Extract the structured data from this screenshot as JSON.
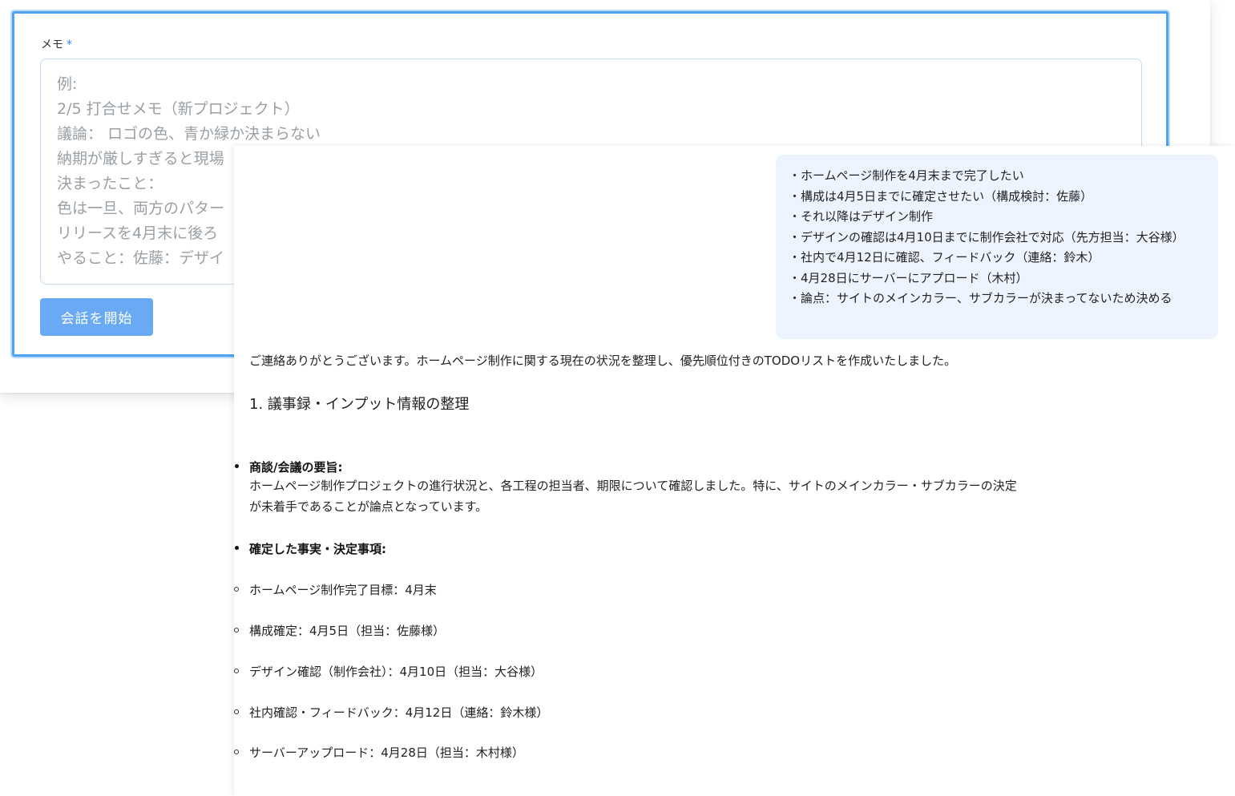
{
  "form": {
    "memo_label": "メモ",
    "required_mark": "*",
    "placeholder_lines": [
      "例:",
      "2/5 打合せメモ（新プロジェクト）",
      "議論： ロゴの色、青か緑か決まらない",
      "納期が厳しすぎると現場",
      "決まったこと：",
      "色は一旦、両方のパター",
      "リリースを4月末に後ろ",
      "やること：佐藤：デザイ"
    ],
    "start_button_label": "会話を開始"
  },
  "chat": {
    "user_message_lines": [
      "・ホームページ制作を4月末まで完了したい",
      "・構成は4月5日までに確定させたい（構成検討：佐藤）",
      "・それ以降はデザイン制作",
      "・デザインの確認は4月10日までに制作会社で対応（先方担当：大谷様）",
      "・社内で4月12日に確認、フィードバック（連絡：鈴木）",
      "・4月28日にサーバーにアプロード（木村）",
      "・論点：サイトのメインカラー、サブカラーが決まってないため決める"
    ],
    "reply": {
      "intro": "ご連絡ありがとうございます。ホームページ制作に関する現在の状況を整理し、優先順位付きのTODOリストを作成いたしました。",
      "section_heading": "1. 議事録・インプット情報の整理",
      "summary_title": "商談/会議の要旨:",
      "summary_body_line1": "ホームページ制作プロジェクトの進行状況と、各工程の担当者、期限について確認しました。特に、サイトのメインカラー・サブカラーの決定",
      "summary_body_line2": "が未着手であることが論点となっています。",
      "facts_title": "確定した事実・決定事項:",
      "facts": [
        "ホームページ制作完了目標：4月末",
        "構成確定：4月5日（担当：佐藤様）",
        "デザイン確認（制作会社）：4月10日（担当：大谷様）",
        "社内確認・フィードバック：4月12日（連絡：鈴木様）",
        "サーバーアップロード：4月28日（担当：木村様）"
      ]
    }
  },
  "colors": {
    "accent": "#4ea3f0",
    "button": "#6aaaf5",
    "user_bubble": "#eef4ff"
  }
}
